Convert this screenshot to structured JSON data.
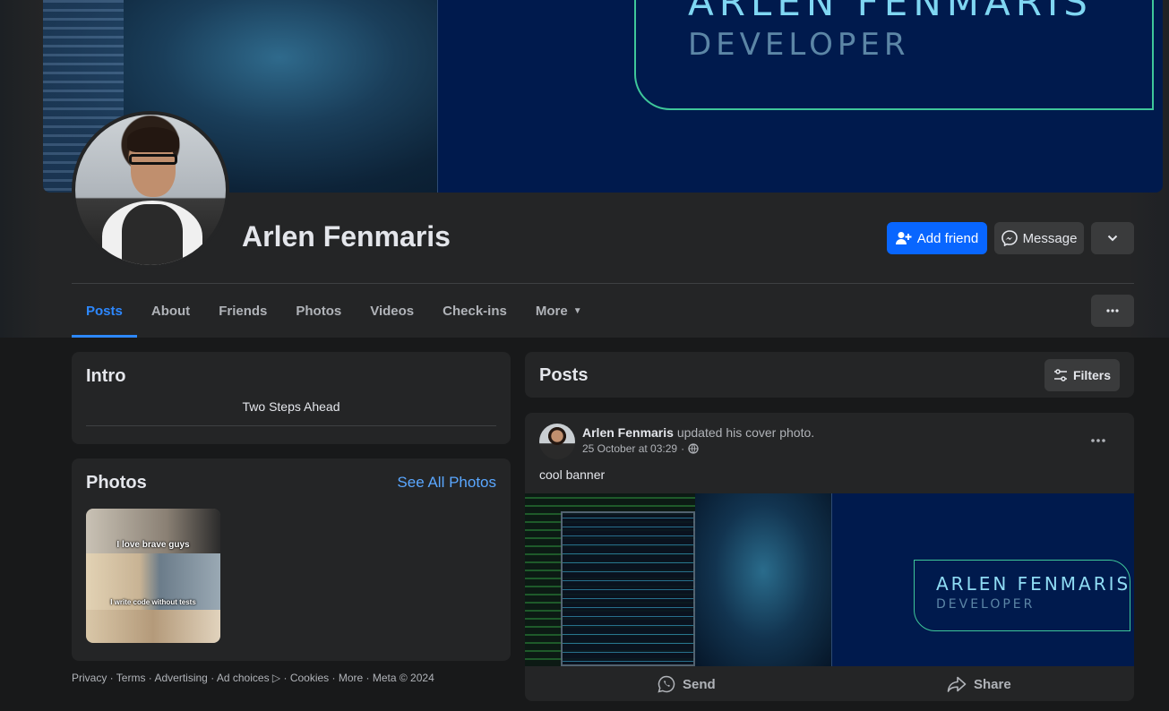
{
  "cover": {
    "banner_name": "ARLEN FENMARIS",
    "banner_role": "DEVELOPER"
  },
  "profile": {
    "name": "Arlen Fenmaris",
    "add_friend_label": "Add friend",
    "message_label": "Message"
  },
  "tabs": [
    "Posts",
    "About",
    "Friends",
    "Photos",
    "Videos",
    "Check-ins",
    "More"
  ],
  "intro": {
    "title": "Intro",
    "bio": "Two Steps Ahead"
  },
  "photos": {
    "title": "Photos",
    "see_all": "See All Photos",
    "meme_top": "I love brave guys",
    "meme_bottom": "I write code without tests"
  },
  "footer": [
    "Privacy",
    "Terms",
    "Advertising",
    "Ad choices",
    "Cookies",
    "More",
    "Meta © 2024"
  ],
  "posts_header": {
    "title": "Posts",
    "filters_label": "Filters"
  },
  "post": {
    "author": "Arlen Fenmaris",
    "action": "updated his cover photo.",
    "timestamp": "25 October at 03:29",
    "text": "cool banner",
    "image_name": "ARLEN FENMARIS",
    "image_role": "DEVELOPER",
    "send_label": "Send",
    "share_label": "Share"
  },
  "colors": {
    "primary": "#0866ff",
    "link": "#5aa7ff",
    "accent_tab": "#2d88ff",
    "banner_outline": "#3ec79a"
  }
}
